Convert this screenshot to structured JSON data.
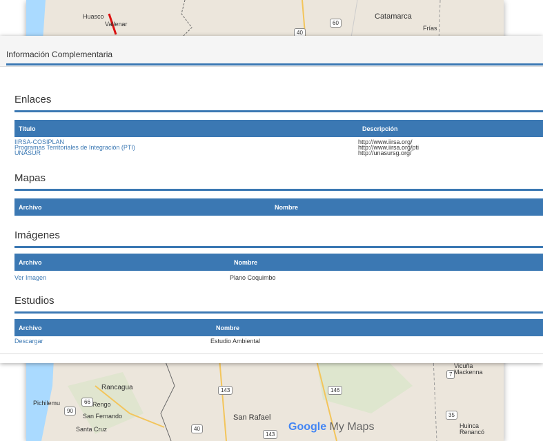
{
  "map": {
    "places": {
      "huasco": "Huasco",
      "vallenar": "Vallenar",
      "catamarca": "Catamarca",
      "frias": "Frías",
      "rancagua": "Rancagua",
      "rengo": "Rengo",
      "pichilemu": "Pichilemu",
      "san_fernando": "San Fernando",
      "santa_cruz": "Santa Cruz",
      "san_rafael": "San Rafael",
      "vicuna_mackenna": "Vicuña\nMackenna",
      "huinca_renanco": "Huinca\nRenancó"
    },
    "road_shields": {
      "r60": "60",
      "r40_top": "40",
      "r66": "66",
      "r90": "90",
      "r143_a": "143",
      "r146": "146",
      "r7": "7",
      "r35": "35",
      "r40_bottom": "40",
      "r143_b": "143"
    },
    "brand_google": "Google",
    "brand_my_maps": " My Maps"
  },
  "panel": {
    "title": "Información Complementaria",
    "sections": {
      "enlaces": {
        "title": "Enlaces",
        "headers": [
          "Título",
          "Descripción"
        ],
        "rows": [
          {
            "title": "IIRSA-COSIPLAN",
            "desc": "http://www.iirsa.org/"
          },
          {
            "title": "Programas Territoriales de Integración (PTI)",
            "desc": "http://www.iirsa.org/pti"
          },
          {
            "title": "UNASUR",
            "desc": "http://unasursg.org/"
          }
        ]
      },
      "mapas": {
        "title": "Mapas",
        "headers": [
          "Archivo",
          "Nombre"
        ]
      },
      "imagenes": {
        "title": "Imágenes",
        "headers": [
          "Archivo",
          "Nombre"
        ],
        "rows": [
          {
            "file": "Ver Imagen",
            "name": "Plano Coquimbo"
          }
        ]
      },
      "estudios": {
        "title": "Estudios",
        "headers": [
          "Archivo",
          "Nombre"
        ],
        "rows": [
          {
            "file": "Descargar",
            "name": "Estudio Ambiental"
          }
        ]
      }
    }
  },
  "colors": {
    "accent": "#3b78b3",
    "map_land": "#ece6dc",
    "map_sea": "#aadaff"
  }
}
